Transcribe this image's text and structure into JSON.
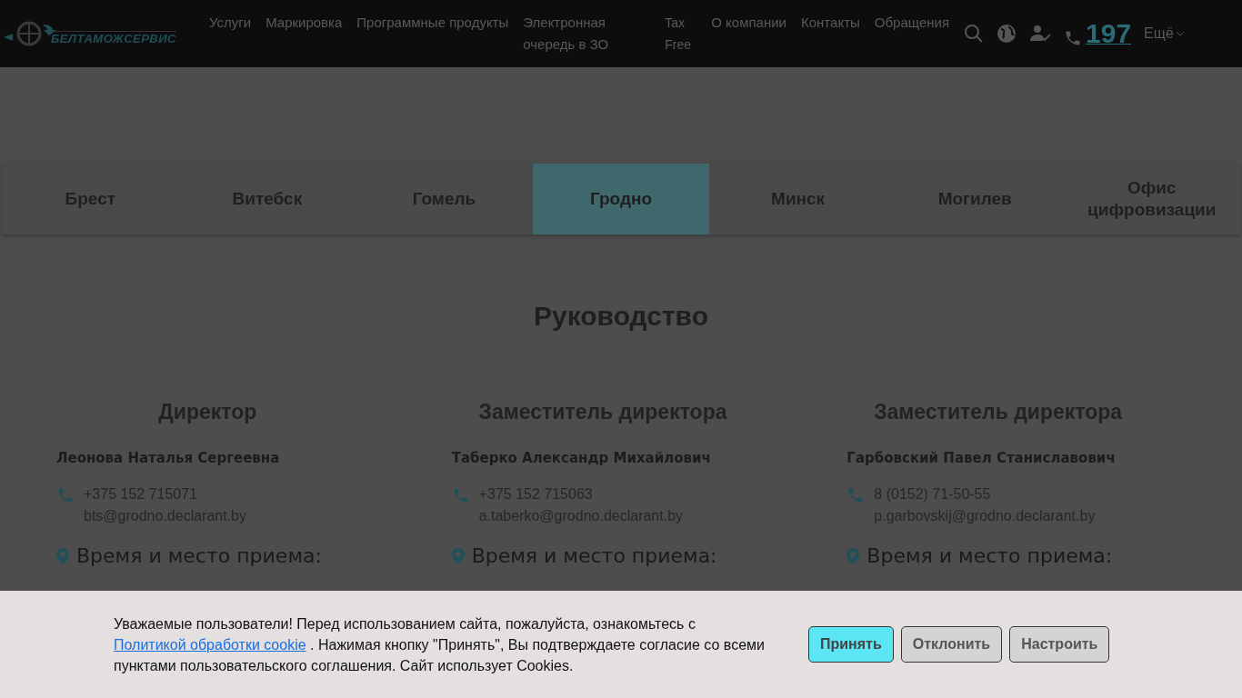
{
  "header": {
    "logo": "БЕЛТАМОЖСЕРВИС",
    "nav": [
      "Услуги",
      "Маркировка",
      "Программные продукты",
      "Электронная очередь в ЗО",
      "Tax Free",
      "О компании",
      "Контакты",
      "Обращения"
    ],
    "phone": "197",
    "more": "Ещё"
  },
  "tabs": [
    {
      "label": "Брест",
      "selected": false
    },
    {
      "label": "Витебск",
      "selected": false
    },
    {
      "label": "Гомель",
      "selected": false
    },
    {
      "label": "Гродно",
      "selected": true
    },
    {
      "label": "Минск",
      "selected": false
    },
    {
      "label": "Могилев",
      "selected": false
    },
    {
      "label": "Офис цифровизации",
      "selected": false
    }
  ],
  "section_title": "Руководство",
  "people": [
    {
      "position": "Директор",
      "name": "Леонова Наталья Сергеевна",
      "phone": "+375 152 715071",
      "email": "bts@grodno.declarant.by",
      "reception_title": "Время и место приема:"
    },
    {
      "position": "Заместитель директора",
      "name": "Таберко Александр Михайлович",
      "phone": "+375 152 715063",
      "email": "a.taberko@grodno.declarant.by",
      "reception_title": "Время и место приема:"
    },
    {
      "position": "Заместитель директора",
      "name": "Гарбовский Павел Станиславович",
      "phone": "8 (0152) 71-50-55",
      "email": "p.garbovskij@grodno.declarant.by",
      "reception_title": "Время и место приема:"
    }
  ],
  "cookie_banner": {
    "text_before": "Уважаемые пользователи! Перед использованием сайта, пожалуйста, ознакомьтесь с",
    "link": "Политикой обработки cookie",
    "text_after": ". Нажимая кнопку \"Принять\", Вы подтверждаете согласие со всеми пунктами пользовательского соглашения. Сайт использует Cookies.",
    "buttons": [
      {
        "label": "Принять",
        "kind": "primary"
      },
      {
        "label": "Отклонить",
        "kind": "secondary"
      },
      {
        "label": "Настроить",
        "kind": "secondary"
      }
    ]
  }
}
